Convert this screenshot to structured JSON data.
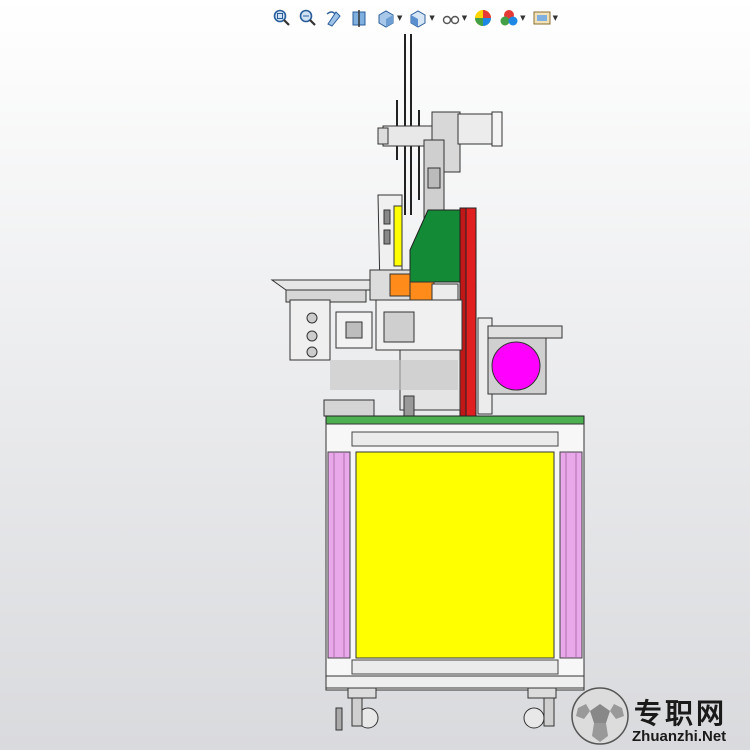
{
  "toolbar": {
    "items": [
      {
        "name": "zoom-to-fit-icon",
        "dropdown": false
      },
      {
        "name": "zoom-to-area-icon",
        "dropdown": false
      },
      {
        "name": "previous-view-icon",
        "dropdown": false
      },
      {
        "name": "section-view-icon",
        "dropdown": false
      },
      {
        "name": "view-orientation-icon",
        "dropdown": true
      },
      {
        "name": "display-style-icon",
        "dropdown": true
      },
      {
        "name": "hide-show-items-icon",
        "dropdown": true
      },
      {
        "name": "edit-appearance-icon",
        "dropdown": false
      },
      {
        "name": "apply-scene-icon",
        "dropdown": true
      },
      {
        "name": "view-settings-icon",
        "dropdown": true
      }
    ]
  },
  "model": {
    "colors": {
      "frame_fill": "#ffffff",
      "frame_line": "#3a3a3a",
      "panel_yellow": "#ffff00",
      "column_pink": "#e9a8e9",
      "top_plate_green": "#4caf50",
      "housing_green": "#138a36",
      "bar_red": "#e02020",
      "block_orange": "#ff8c1a",
      "motor_magenta": "#ff00ff",
      "metal_gray": "#c8c8c8"
    }
  },
  "watermark": {
    "cn": "专职网",
    "en": "Zhuanzhi.Net"
  }
}
